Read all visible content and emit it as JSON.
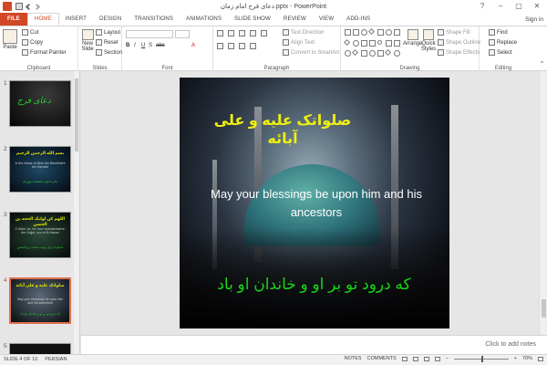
{
  "title_bar": {
    "title": "دعای فرج امام زمان.pptx - PowerPoint",
    "window_controls": [
      "?",
      "–",
      "▢",
      "✕"
    ]
  },
  "tabs": [
    "FILE",
    "HOME",
    "INSERT",
    "DESIGN",
    "TRANSITIONS",
    "ANIMATIONS",
    "SLIDE SHOW",
    "REVIEW",
    "VIEW",
    "ADD-INS"
  ],
  "active_tab": "HOME",
  "sign_in": "Sign in",
  "ribbon": {
    "clipboard": {
      "label": "Clipboard",
      "paste": "Paste",
      "cut": "Cut",
      "copy": "Copy",
      "format_painter": "Format Painter"
    },
    "slides": {
      "label": "Slides",
      "new_slide": "New Slide",
      "layout": "Layout",
      "reset": "Reset",
      "section": "Section"
    },
    "font": {
      "label": "Font"
    },
    "paragraph": {
      "label": "Paragraph",
      "text_direction": "Text Direction",
      "align_text": "Align Text",
      "convert_smartart": "Convert to SmartArt"
    },
    "drawing": {
      "label": "Drawing",
      "arrange": "Arrange",
      "quick_styles": "Quick Styles",
      "shape_fill": "Shape Fill",
      "shape_outline": "Shape Outline",
      "shape_effects": "Shape Effects"
    },
    "editing": {
      "label": "Editing",
      "find": "Find",
      "replace": "Replace",
      "select": "Select"
    }
  },
  "thumbnails": [
    {
      "num": "1",
      "main": "دعای فرج"
    },
    {
      "num": "2",
      "title": "بسم الله الرحمن الرحیم",
      "english": "In the Name of Allah the Beneficent the Merciful",
      "farsi": "بنام خداوند بخشنده مهربان"
    },
    {
      "num": "3",
      "title": "اللهم کن لولیک الحجه بن الحسن",
      "english": "O Allah, be, for Your representative, the Hujjat, son of Al-Hasan",
      "farsi": "خداوندا برای ولیت حجت بن الحسن"
    },
    {
      "num": "4",
      "title": "صلواتک علیه و علی آبائه",
      "english": "May your blessings be upon him and his ancestors",
      "farsi": "که درود تو بر او و خاندان او باد"
    },
    {
      "num": "5"
    }
  ],
  "slide": {
    "title": "صلواتک علیه و علی آبائه",
    "english": "May your blessings be upon him and his ancestors",
    "farsi": "که درود تو بر او و خاندان او باد"
  },
  "notes_placeholder": "Click to add notes",
  "status": {
    "slide_info": "SLIDE 4 OF 10",
    "language": "PERSIAN",
    "notes": "NOTES",
    "comments": "COMMENTS",
    "zoom": "70%"
  },
  "colors": {
    "accent": "#d24726",
    "slide_title": "#f0ef12",
    "slide_farsi": "#17d617"
  }
}
